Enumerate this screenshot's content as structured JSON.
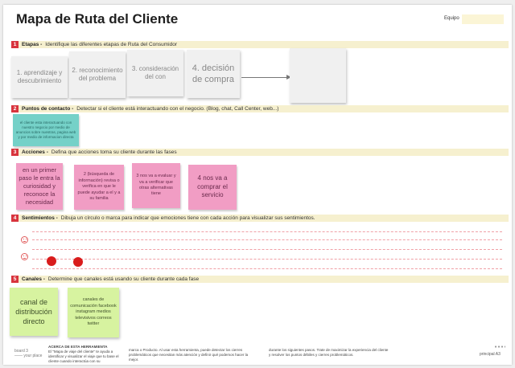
{
  "header": {
    "title": "Mapa de Ruta del Cliente",
    "team_label": "Equipo"
  },
  "sections": [
    {
      "num": "1",
      "title": "Etapas -",
      "desc": "Identifique las diferentes etapas de Ruta del Consumidor"
    },
    {
      "num": "2",
      "title": "Puntos de contacto -",
      "desc": "Detectar si el cliente está interactuando con el negocio. (Blog, chat, Call Center, web...)"
    },
    {
      "num": "3",
      "title": "Acciones -",
      "desc": "Defina que acciones toma su cliente durante las fases"
    },
    {
      "num": "4",
      "title": "Sentimientos -",
      "desc": "Dibuja un círculo o marca para indicar que  emociones tiene con cada acción para visualizar sus sentimientos."
    },
    {
      "num": "5",
      "title": "Canales -",
      "desc": "Determine que canales está usando su cliente durante cada fase"
    }
  ],
  "stages": [
    "1. aprendizaje y descubrimiento",
    "2. reconocimiento del problema",
    "3. consideración del con",
    "4. decisión de compra",
    ""
  ],
  "touchpoints": [
    "el cliente esta interactuando con nuestro negocio por medio de anuncios sobre nuestras, pagina web y por medio de informacion directa"
  ],
  "actions": [
    "en un primer paso le entra la curiosidad y reconoce la necesidad",
    "2 (búsqueda de información) revisa o verifica en que le puede ayudar a el y a su familia",
    "3 nos va a evaluar y va a verificar que otras alternativas tiene",
    "4 nos va a comprar el servicio"
  ],
  "channels": [
    "canal de distribución directo",
    "canales de comunicación facebook instagram medios televisivos correos twitter"
  ],
  "footer": {
    "logo_line1": "board 3",
    "logo_line2": "—— your place",
    "about_title": "ACERCA DE ESTA HERRAMIENTA",
    "about_text": "El \"Mapa de viaje del cliente\" te ayuda a identificar y visualizar el viaje que tu base el cliente cuando interactúa con su",
    "col2_text": "marca o Producto. Al usar esta herramienta, puede detectar los cierres problemáticos que necesitan más atención y definir qué podemos hacer la mejor.",
    "col3_text": "durante los siguientes pasos. Trate de maximizar la experiencia del cliente y resolver los puntos débiles y cierres problemáticos.",
    "page": "principal  A3"
  },
  "colors": {
    "accent_red": "#d8343d",
    "band_yellow": "#f6f0cf",
    "sticky_pink": "#f19dc4",
    "sticky_teal": "#75d1c8",
    "sticky_green": "#d7f3a0",
    "sticky_grey": "#f0f0f0"
  }
}
